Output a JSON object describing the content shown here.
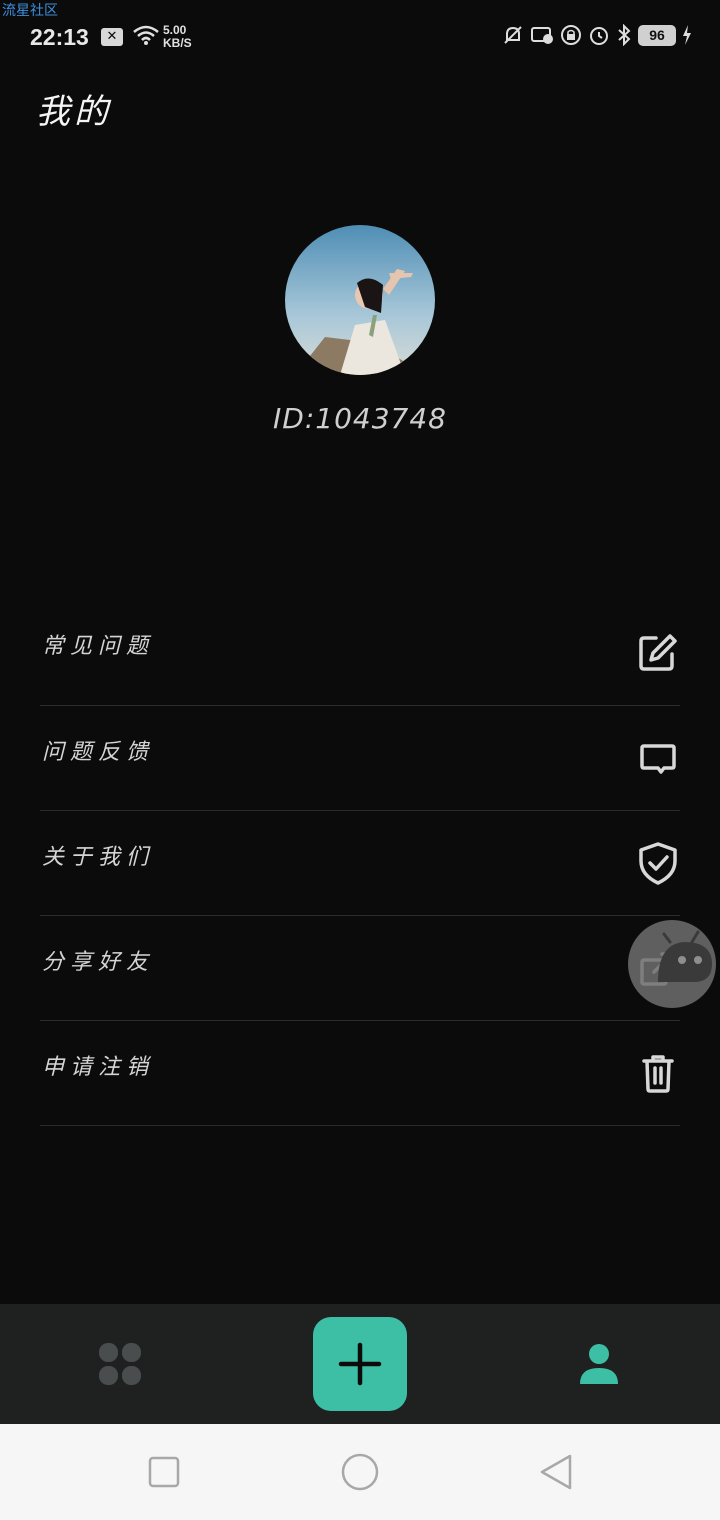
{
  "watermark": "流星社区",
  "status": {
    "time": "22:13",
    "x_badge": "✕",
    "speed_value": "5.00",
    "speed_unit": "KB/S",
    "battery": "96"
  },
  "page": {
    "title": "我的"
  },
  "profile": {
    "id_text": "ID:1043748"
  },
  "menu": {
    "items": [
      {
        "label": "常见问题",
        "icon": "edit-icon"
      },
      {
        "label": "问题反馈",
        "icon": "message-icon"
      },
      {
        "label": "关于我们",
        "icon": "shield-check-icon"
      },
      {
        "label": "分享好友",
        "icon": "share-icon"
      },
      {
        "label": "申请注销",
        "icon": "trash-icon"
      }
    ]
  },
  "tabbar": {
    "tabs": [
      {
        "name": "home",
        "icon": "grid-icon"
      },
      {
        "name": "add",
        "icon": "plus-icon"
      },
      {
        "name": "profile",
        "icon": "person-icon",
        "active": true
      }
    ]
  },
  "colors": {
    "accent": "#3dbfa6",
    "background": "#0b0b0b",
    "tabbar": "#1f2121"
  }
}
